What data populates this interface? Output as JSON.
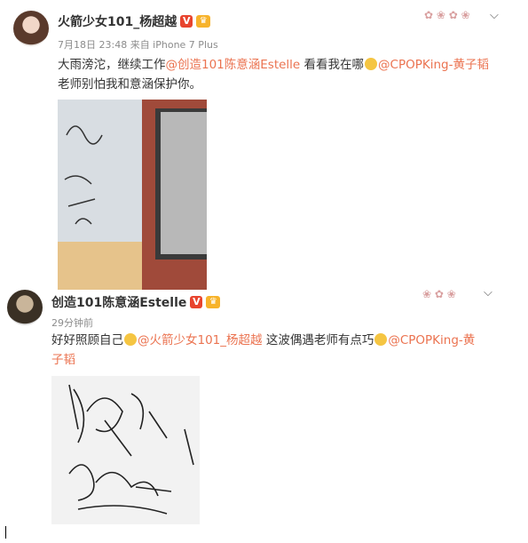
{
  "post1": {
    "author": "火箭少女101_杨超越",
    "meta": "7月18日 23:48 来自 iPhone 7 Plus",
    "text_a": "大雨滂沱，继续工作",
    "mention_a": "@创造101陈意涵Estelle",
    "text_b": " 看看我在哪",
    "mention_b": "@CPOPKing-黄子韬",
    "text_c": "老师别怕我和意涵保护你。",
    "verified_icon": "v-badge-icon",
    "crown_icon": "vip-crown-icon"
  },
  "post2": {
    "author": "创造101陈意涵Estelle",
    "meta": "29分钟前",
    "text_a": "好好照顾自己",
    "mention_a": "@火箭少女101_杨超越",
    "text_b": " 这波偶遇老师有点巧",
    "mention_b": "@CPOPKing-黄",
    "text_c": "子韬",
    "verified_icon": "v-badge-icon",
    "crown_icon": "vip-crown-icon"
  },
  "colors": {
    "mention": "#eb7350",
    "meta": "#8c8c8c",
    "badge": "#e8442e"
  }
}
